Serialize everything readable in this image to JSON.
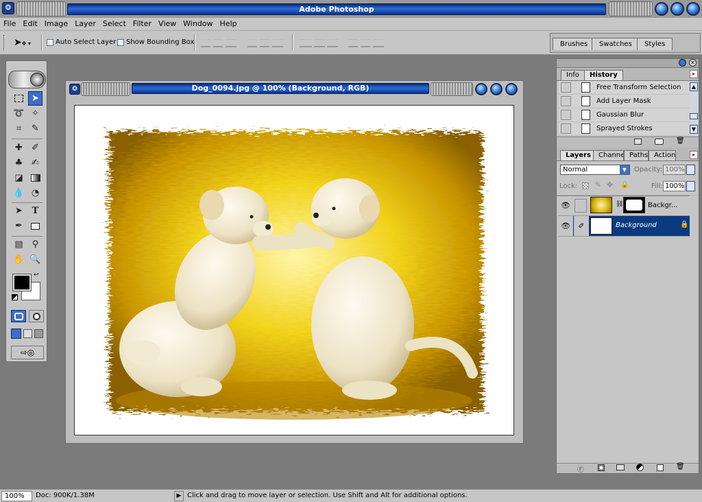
{
  "app": {
    "title": "Adobe Photoshop"
  },
  "menu": [
    "File",
    "Edit",
    "Image",
    "Layer",
    "Select",
    "Filter",
    "View",
    "Window",
    "Help"
  ],
  "options": {
    "auto_select": "Auto Select Layer",
    "bounding_box": "Show Bounding Box",
    "palette_tabs": [
      "Brushes",
      "Swatches",
      "Styles"
    ]
  },
  "document": {
    "title": "Dog_0094.jpg @ 100% (Background, RGB)"
  },
  "history_panel": {
    "tabs": [
      "Info",
      "History"
    ],
    "items": [
      "Free Transform Selection",
      "Add Layer Mask",
      "Gaussian Blur",
      "Sprayed Strokes"
    ]
  },
  "layers_panel": {
    "tabs": [
      "Layers",
      "Channels",
      "Paths",
      "Actions"
    ],
    "blend_mode": "Normal",
    "opacity_label": "Opacity:",
    "opacity": "100%",
    "lock_label": "Lock:",
    "fill_label": "Fill:",
    "fill": "100%",
    "layers": [
      {
        "name": "Backgr...",
        "selected": false
      },
      {
        "name": "Background",
        "selected": true
      }
    ]
  },
  "status": {
    "zoom": "100%",
    "doc": "Doc: 900K/1.38M",
    "hint": "Click and drag to move layer or selection.  Use Shift and Alt for additional options."
  },
  "colors": {
    "accent": "#0b3a7e",
    "title_blue": "#2c6ad6",
    "chrome": "#c6c6c6"
  },
  "icons": [
    "move-tool-icon",
    "marquee-icon",
    "lasso-icon",
    "magic-wand-icon",
    "crop-icon",
    "slice-icon",
    "healing-brush-icon",
    "brush-icon",
    "stamp-icon",
    "history-brush-icon",
    "eraser-icon",
    "gradient-icon",
    "blur-icon",
    "dodge-icon",
    "path-select-icon",
    "type-icon",
    "pen-icon",
    "shape-icon",
    "notes-icon",
    "eyedropper-icon",
    "hand-icon",
    "zoom-icon",
    "eye-icon",
    "lock-icon",
    "trash-icon"
  ]
}
